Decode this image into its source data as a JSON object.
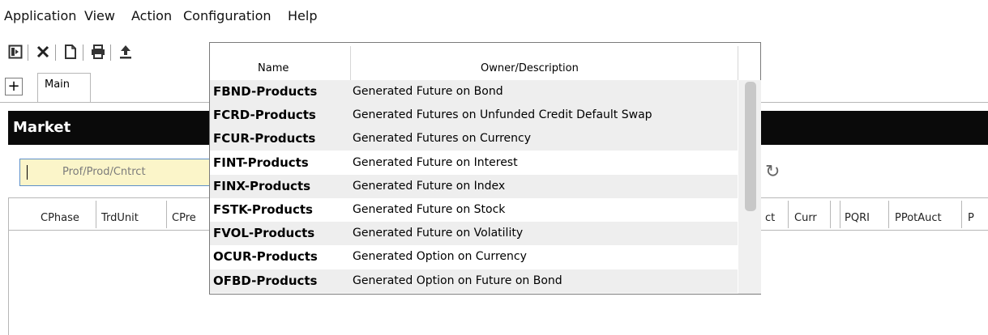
{
  "menu": [
    "Application",
    "View",
    "Action",
    "Configuration",
    "Help"
  ],
  "toolbar": {
    "icons": [
      "panel-toggle-icon",
      "close-icon",
      "document-icon",
      "print-icon",
      "upload-icon"
    ]
  },
  "tabs": {
    "add_label": "+",
    "main_label": "Main"
  },
  "panel": {
    "title": "Market",
    "search_placeholder": "Prof/Prod/Cntrct",
    "left_columns": [
      "CPhase",
      "TrdUnit",
      "CPre"
    ],
    "right_columns": [
      "ct",
      "Curr",
      "PQRI",
      "PPotAuct",
      "P"
    ]
  },
  "popup": {
    "headers": {
      "name": "Name",
      "description": "Owner/Description"
    },
    "rows": [
      {
        "name": "FBND-Products",
        "desc": "Generated Future on Bond",
        "highlighted": true
      },
      {
        "name": "FCRD-Products",
        "desc": "Generated Futures on Unfunded Credit Default Swap",
        "highlighted": true
      },
      {
        "name": "FCUR-Products",
        "desc": "Generated Futures on Currency",
        "highlighted": true
      },
      {
        "name": "FINT-Products",
        "desc": "Generated Future on Interest",
        "highlighted": false
      },
      {
        "name": "FINX-Products",
        "desc": "Generated Future on Index",
        "highlighted": true
      },
      {
        "name": "FSTK-Products",
        "desc": "Generated Future on Stock",
        "highlighted": false
      },
      {
        "name": "FVOL-Products",
        "desc": "Generated Future on Volatility",
        "highlighted": true
      },
      {
        "name": "OCUR-Products",
        "desc": "Generated Option on Currency",
        "highlighted": false
      },
      {
        "name": "OFBD-Products",
        "desc": "Generated Option on Future on Bond",
        "highlighted": true
      }
    ]
  },
  "colors": {
    "header_bg": "#0a0a0a",
    "search_bg": "#fbf5c9",
    "search_border": "#5b8fc9",
    "row_highlight": "#eeeeee"
  }
}
